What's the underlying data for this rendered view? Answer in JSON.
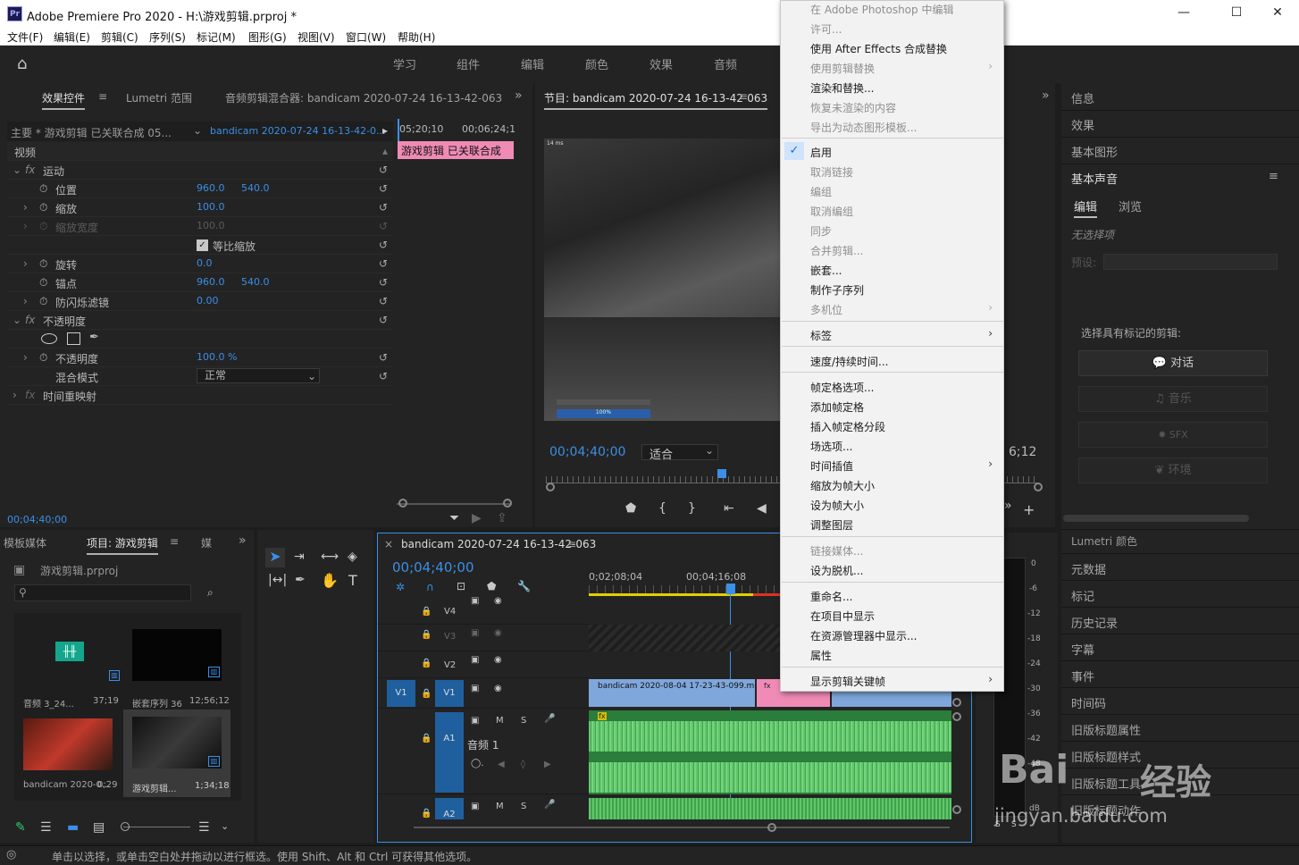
{
  "app": {
    "logo": "Pr",
    "title": "Adobe Premiere Pro 2020 - H:\\游戏剪辑.prproj *"
  },
  "menu": [
    "文件(F)",
    "编辑(E)",
    "剪辑(C)",
    "序列(S)",
    "标记(M)",
    "图形(G)",
    "视图(V)",
    "窗口(W)",
    "帮助(H)"
  ],
  "workspaces": [
    "学习",
    "组件",
    "编辑",
    "颜色",
    "效果",
    "音频"
  ],
  "effect_controls": {
    "tabs": [
      "效果控件",
      "Lumetri 范围",
      "音频剪辑混合器: bandicam 2020-07-24 16-13-42-063"
    ],
    "source": "主要 * 游戏剪辑 已关联合成 05...",
    "clip": "bandicam 2020-07-24 16-13-42-0...",
    "time_a": "05;20;10",
    "time_b": "00;06;24;1",
    "clip_bar": "游戏剪辑 已关联合成",
    "section_video": "视频",
    "fx_motion": "运动",
    "position_label": "位置",
    "position_x": "960.0",
    "position_y": "540.0",
    "scale_label": "缩放",
    "scale_value": "100.0",
    "scale_width_label": "缩放宽度",
    "scale_width_value": "100.0",
    "uniform_label": "等比缩放",
    "rotation_label": "旋转",
    "rotation_value": "0.0",
    "anchor_label": "锚点",
    "anchor_x": "960.0",
    "anchor_y": "540.0",
    "flicker_label": "防闪烁滤镜",
    "flicker_value": "0.00",
    "fx_opacity": "不透明度",
    "opacity_label": "不透明度",
    "opacity_value": "100.0 %",
    "blend_label": "混合模式",
    "blend_value": "正常",
    "time_remap": "时间重映射",
    "timecode": "00;04;40;00"
  },
  "program": {
    "title": "节目: bandicam 2020-07-24 16-13-42-063",
    "timecode": "00;04;40;00",
    "fit": "适合",
    "end_time": "6;12",
    "overlay_text": "14 ms",
    "meter_label": "100%"
  },
  "project": {
    "tabs": [
      "模板媒体",
      "项目: 游戏剪辑",
      "媒"
    ],
    "file": "游戏剪辑.prproj",
    "items": [
      {
        "name": "音频 3_24...",
        "dur": "37;19"
      },
      {
        "name": "嵌套序列 36",
        "dur": "12;56;12"
      },
      {
        "name": "bandicam 2020-0...",
        "dur": "0;29"
      },
      {
        "name": "游戏剪辑...",
        "dur": "1;34;18"
      }
    ]
  },
  "timeline": {
    "title": "bandicam 2020-07-24 16-13-42-063",
    "timecode": "00;04;40;00",
    "ruler": [
      "0;02;08;04",
      "00;04;16;08"
    ],
    "tracks": [
      "V4",
      "V3",
      "V2",
      "V1",
      "A1",
      "A2"
    ],
    "v1_clip": "bandicam 2020-08-04 17-23-43-099.mp4",
    "a1_name": "音频 1",
    "m": "M",
    "s": "S"
  },
  "audio_meter": [
    "0",
    "-6",
    "-12",
    "-18",
    "-24",
    "-30",
    "-36",
    "-42",
    "-48",
    "dB"
  ],
  "meter_buttons": [
    "S",
    "S"
  ],
  "context_menu": {
    "items": [
      {
        "label": "在 Adobe Photoshop 中编辑",
        "enabled": false
      },
      {
        "label": "许可...",
        "enabled": false
      },
      {
        "label": "使用 After Effects 合成替换",
        "enabled": true
      },
      {
        "label": "使用剪辑替换",
        "enabled": false,
        "submenu": true
      },
      {
        "label": "渲染和替换...",
        "enabled": true
      },
      {
        "label": "恢复未渲染的内容",
        "enabled": false
      },
      {
        "label": "导出为动态图形模板...",
        "enabled": false
      },
      {
        "label": "启用",
        "enabled": true,
        "checked": true
      },
      {
        "label": "取消链接",
        "enabled": false
      },
      {
        "label": "编组",
        "enabled": false
      },
      {
        "label": "取消编组",
        "enabled": false
      },
      {
        "label": "同步",
        "enabled": false
      },
      {
        "label": "合并剪辑...",
        "enabled": false
      },
      {
        "label": "嵌套...",
        "enabled": true
      },
      {
        "label": "制作子序列",
        "enabled": true
      },
      {
        "label": "多机位",
        "enabled": false,
        "submenu": true
      },
      {
        "label": "标签",
        "enabled": true,
        "submenu": true
      },
      {
        "label": "速度/持续时间...",
        "enabled": true
      },
      {
        "label": "帧定格选项...",
        "enabled": true
      },
      {
        "label": "添加帧定格",
        "enabled": true
      },
      {
        "label": "插入帧定格分段",
        "enabled": true
      },
      {
        "label": "场选项...",
        "enabled": true
      },
      {
        "label": "时间插值",
        "enabled": true,
        "submenu": true
      },
      {
        "label": "缩放为帧大小",
        "enabled": true
      },
      {
        "label": "设为帧大小",
        "enabled": true
      },
      {
        "label": "调整图层",
        "enabled": true
      },
      {
        "label": "链接媒体...",
        "enabled": false
      },
      {
        "label": "设为脱机...",
        "enabled": true
      },
      {
        "label": "重命名...",
        "enabled": true
      },
      {
        "label": "在项目中显示",
        "enabled": true
      },
      {
        "label": "在资源管理器中显示...",
        "enabled": true
      },
      {
        "label": "属性",
        "enabled": true
      },
      {
        "label": "显示剪辑关键帧",
        "enabled": true,
        "submenu": true
      }
    ]
  },
  "right_panel": {
    "top": [
      "信息",
      "效果",
      "基本图形",
      "基本声音"
    ],
    "sound_tabs": [
      "编辑",
      "浏览"
    ],
    "no_selection": "无选择项",
    "preset": "预设:",
    "choose": "选择具有标记的剪辑:",
    "buttons": [
      "对话",
      "音乐",
      "SFX",
      "环境"
    ],
    "bottom": [
      "Lumetri 颜色",
      "元数据",
      "标记",
      "历史记录",
      "字幕",
      "事件",
      "时间码",
      "旧版标题属性",
      "旧版标题样式",
      "旧版标题工具",
      "旧版标题动作"
    ]
  },
  "status": "单击以选择，或单击空白处并拖动以进行框选。使用 Shift、Alt 和 Ctrl 可获得其他选项。",
  "watermark": {
    "brand": "Bai",
    "cn": "经验",
    "url": "jingyan.baidu.com"
  }
}
